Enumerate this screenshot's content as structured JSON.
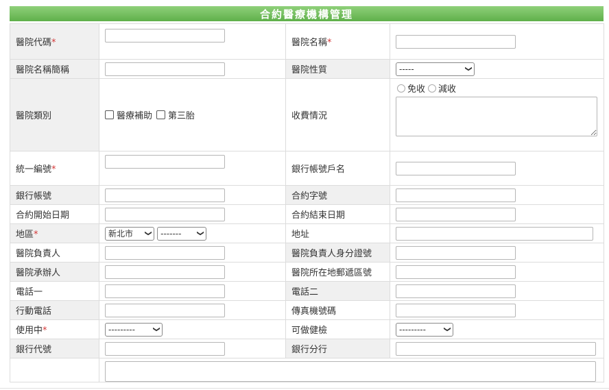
{
  "page_title": "合約醫療機構管理",
  "fields": {
    "hospital_code": "醫院代碼",
    "hospital_name": "醫院名稱",
    "hospital_short_name": "醫院名稱簡稱",
    "hospital_nature": "醫院性質",
    "hospital_category": "醫院類別",
    "fee_status": "收費情況",
    "tax_id": "統一編號",
    "bank_account_name": "銀行帳號戶名",
    "bank_account": "銀行帳號",
    "contract_number": "合約字號",
    "contract_start": "合約開始日期",
    "contract_end": "合約結束日期",
    "region": "地區",
    "address": "地址",
    "hospital_director": "醫院負責人",
    "director_id": "醫院負責人身分證號",
    "hospital_contact": "醫院承辦人",
    "postal_code": "醫院所在地郵遞區號",
    "phone1": "電話一",
    "phone2": "電話二",
    "mobile": "行動電話",
    "fax": "傳真機號碼",
    "in_use": "使用中",
    "health_check": "可做健檢",
    "bank_code": "銀行代號",
    "bank_branch": "銀行分行"
  },
  "required_mark": "*",
  "selects": {
    "hospital_nature": "-----",
    "region_city": "新北市",
    "region_district": "-------",
    "in_use": "---------",
    "health_check": "---------"
  },
  "checkboxes": {
    "medical_subsidy": "醫療補助",
    "third_child": "第三胎"
  },
  "radios": {
    "free": "免收",
    "reduced": "減收"
  }
}
